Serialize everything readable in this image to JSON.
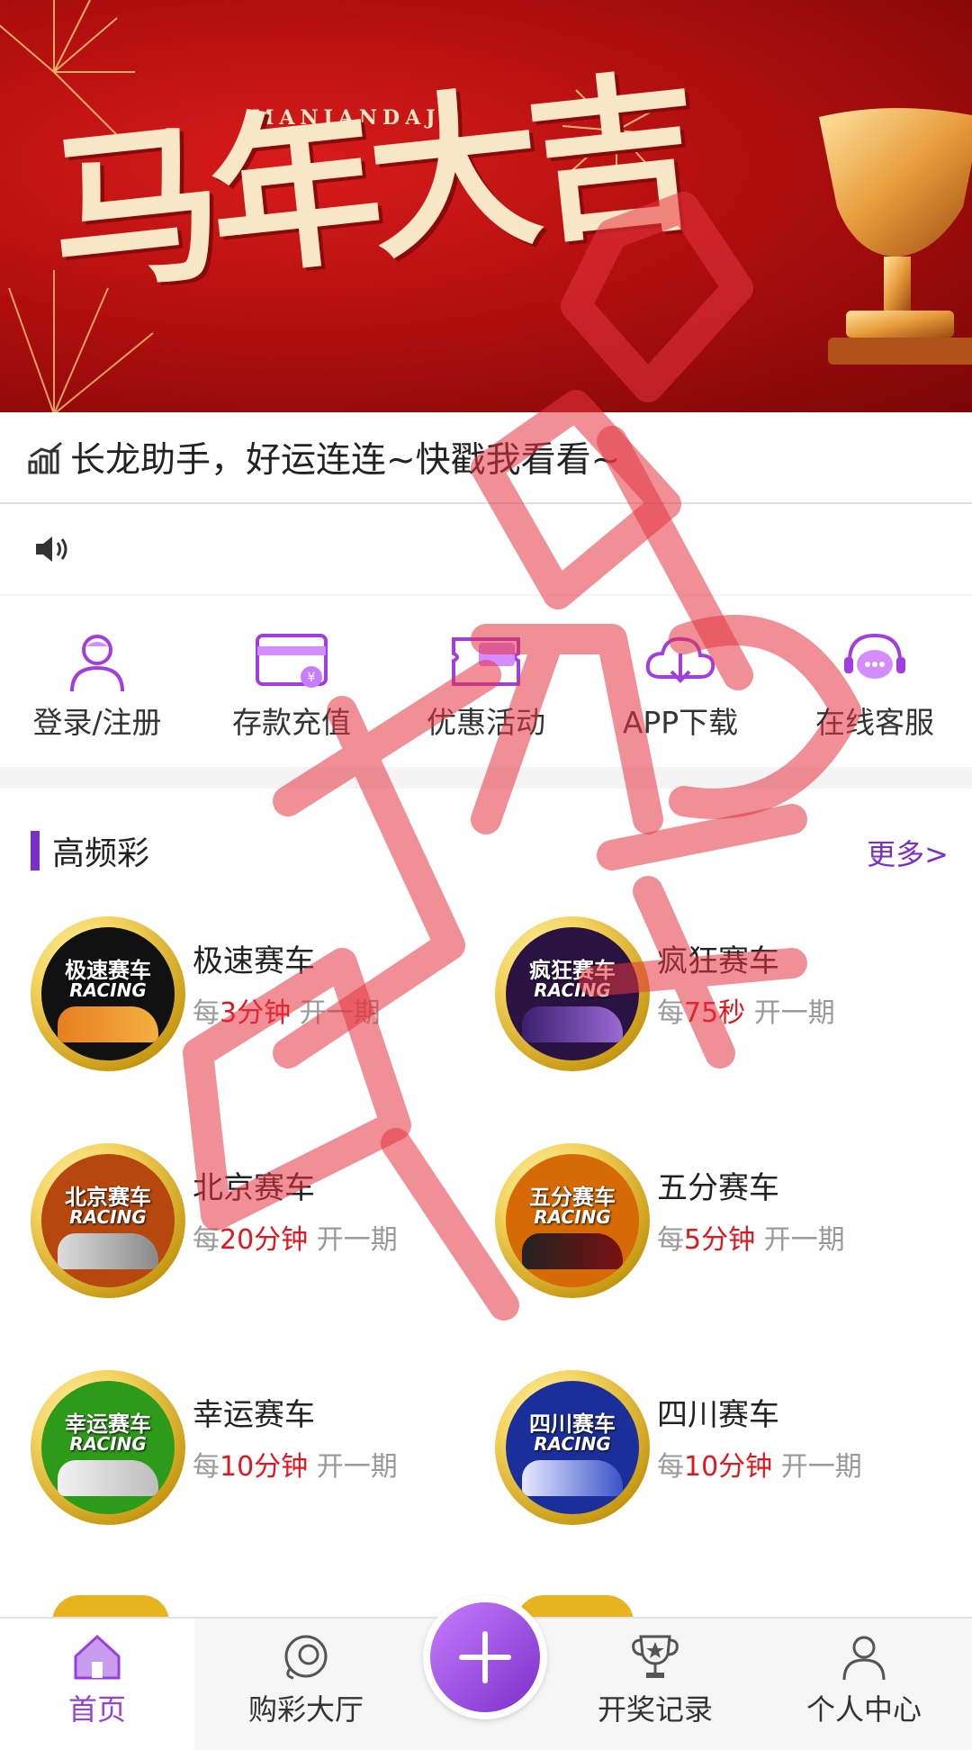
{
  "banner": {
    "subtitle": "MANIANDAJI",
    "title": "马年大吉"
  },
  "notice": {
    "text": "长龙助手，好运连连~快戳我看看~"
  },
  "quick_nav": [
    {
      "label": "登录/注册",
      "icon": "user-icon"
    },
    {
      "label": "存款充值",
      "icon": "card-icon"
    },
    {
      "label": "优惠活动",
      "icon": "gift-ticket-icon"
    },
    {
      "label": "APP下载",
      "icon": "cloud-download-icon"
    },
    {
      "label": "在线客服",
      "icon": "chat-headset-icon"
    }
  ],
  "section": {
    "title": "高频彩",
    "more": "更多>"
  },
  "games": [
    {
      "badge": "极速赛车",
      "badge_en": "RACING",
      "name": "极速赛车",
      "prefix": "每",
      "interval": "3分钟",
      "suffix": "开一期",
      "color": "#111111"
    },
    {
      "badge": "疯狂赛车",
      "badge_en": "RACING",
      "name": "疯狂赛车",
      "prefix": "每",
      "interval": "75秒",
      "suffix": "开一期",
      "color": "#2a1242"
    },
    {
      "badge": "北京赛车",
      "badge_en": "RACING",
      "name": "北京赛车",
      "prefix": "每",
      "interval": "20分钟",
      "suffix": "开一期",
      "color": "#b5470f"
    },
    {
      "badge": "五分赛车",
      "badge_en": "RACING",
      "name": "五分赛车",
      "prefix": "每",
      "interval": "5分钟",
      "suffix": "开一期",
      "color": "#d56a06"
    },
    {
      "badge": "幸运赛车",
      "badge_en": "RACING",
      "name": "幸运赛车",
      "prefix": "每",
      "interval": "10分钟",
      "suffix": "开一期",
      "color": "#2e9a1a"
    },
    {
      "badge": "四川赛车",
      "badge_en": "RACING",
      "name": "四川赛车",
      "prefix": "每",
      "interval": "10分钟",
      "suffix": "开一期",
      "color": "#1b2f9b"
    }
  ],
  "tabbar": [
    {
      "label": "首页",
      "icon": "home-icon",
      "active": true
    },
    {
      "label": "购彩大厅",
      "icon": "lottery-ball-icon",
      "active": false
    },
    {
      "label": "开奖记录",
      "icon": "trophy-icon",
      "active": false
    },
    {
      "label": "个人中心",
      "icon": "person-icon",
      "active": false
    }
  ],
  "colors": {
    "accent": "#7b2fc9",
    "highlight": "#e2161c",
    "banner_red": "#b30f0f"
  }
}
